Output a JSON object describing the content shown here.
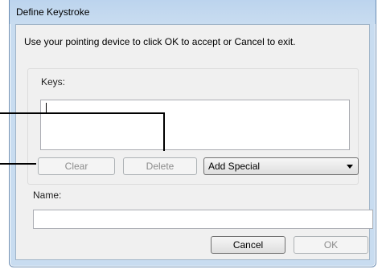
{
  "window": {
    "title": "Define Keystroke"
  },
  "dialog": {
    "instructions": "Use your pointing device to click OK to accept or Cancel to exit.",
    "keys_label": "Keys:",
    "keys_value": "",
    "clear_label": "Clear",
    "delete_label": "Delete",
    "add_special_value": "Add Special",
    "name_label": "Name:",
    "name_value": "",
    "cancel_label": "Cancel",
    "ok_label": "OK"
  },
  "icons": {
    "dropdown": "chevron-down-icon"
  }
}
